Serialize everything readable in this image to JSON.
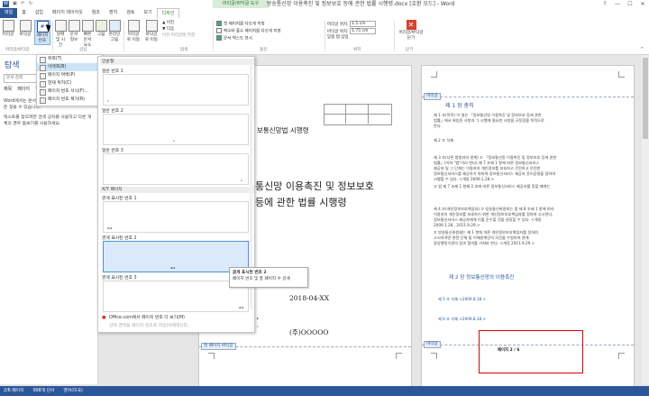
{
  "window": {
    "title": "방송통신망 이용촉진 및 정보보호 등에 관한 법률 시행령.docx [호환 모드] - Word",
    "context_group": "머리글/바닥글 도구",
    "controls": [
      "?",
      "—",
      "☐",
      "✕"
    ]
  },
  "tabs": [
    "파일",
    "홈",
    "삽입",
    "페이지 레이아웃",
    "참조",
    "편지",
    "검토",
    "보기",
    "디자인"
  ],
  "ribbon": {
    "header_footer": {
      "header": "머리글",
      "footer": "바닥글",
      "page_number": "페이지 번호",
      "group": "머리글/바닥글"
    },
    "insert": {
      "datetime": "날짜 및 시간",
      "docinfo": "문서 정보",
      "quick": "빠른 문서 요소",
      "picture": "그림",
      "online": "온라인 그림",
      "group": "삽입"
    },
    "nav": {
      "go_header": "머리글로 이동",
      "go_footer": "바닥글로 이동",
      "prev": "이전",
      "next": "다음",
      "link": "이전 머리글에 연결",
      "group": "탐색"
    },
    "options": {
      "first_page": "첫 페이지를 다르게 지정",
      "odd_even": "짝수와 홀수 페이지를 다르게 지정",
      "show_text": "문서 텍스트 표시",
      "group": "옵션"
    },
    "position": {
      "header_top": "머리글 위치:",
      "header_val": "1.5 cm",
      "footer_bottom": "바닥글 위치:",
      "footer_val": "1.75 cm",
      "align_tab": "맞춤 탭 삽입",
      "group": "위치"
    },
    "close": {
      "label": "머리글/바닥글 닫기",
      "group": "닫기"
    }
  },
  "nav_pane": {
    "title": "탐색",
    "search_placeholder": "문서 검색",
    "tabs": [
      "제목",
      "페이지",
      "결과"
    ],
    "text1": "Word에서는 문서에서 텍스트, 표, 그림 등 무엇이든 찾을 수 있습니다.",
    "text2": "텍스트를 찾으려면 검색 상자를 사용하고 다른 개체의 경우 돋보기를 사용하세요."
  },
  "page_number_menu": [
    {
      "label": "위쪽(T)",
      "arrow": "▸",
      "highlighted": false
    },
    {
      "label": "아래쪽(B)",
      "arrow": "▸",
      "highlighted": true
    },
    {
      "label": "페이지 여백(P)",
      "arrow": "▸",
      "highlighted": false
    },
    {
      "label": "현재 위치(C)",
      "arrow": "▸",
      "highlighted": false
    },
    {
      "label": "페이지 번호 서식(F)...",
      "arrow": "",
      "highlighted": false
    },
    {
      "label": "페이지 번호 제거(R)",
      "arrow": "",
      "highlighted": false
    }
  ],
  "gallery": {
    "section1": "단순형",
    "items": [
      {
        "label": "일반 번호 1",
        "num": "1"
      },
      {
        "label": "일반 번호 2",
        "num": "1"
      },
      {
        "label": "일반 번호 3",
        "num": "1"
      }
    ],
    "section2": "X/Y 페이지",
    "xy_items": [
      {
        "label": "굵게 표시된 번호 1",
        "num": "1/1"
      },
      {
        "label": "굵게 표시된 번호 2",
        "num": "1/1"
      },
      {
        "label": "굵게 표시된 번호 3",
        "num": "1/1"
      }
    ],
    "more": "Office.com에서 페이지 번호 더 보기(M)",
    "save": "선택 영역을 페이지 번호로 저장(아래쪽)(S)"
  },
  "tooltip": {
    "title": "굵게 표시된 번호 2",
    "desc": "페이지 번호 및 총 페이지 수 굵게"
  },
  "doc": {
    "page1": {
      "subtitle": "보통신망법 시행령",
      "title_line1": "통신망 이용촉진 및 정보보호",
      "title_line2": "등에 관한 법률 시행령",
      "date": "2018-04-XX",
      "org": "(주)OOOOO",
      "footer_tag": "첫 페이지 바닥글"
    },
    "page2": {
      "header_tag": "머리글",
      "chapter1": "제 1 장 총칙",
      "lines": [
        "제 1 조(목적) 이 영은 「정보통신망 이용촉진 및 정보보호 등에 관한",
        "법률」에서 위임된 사항과 그 시행에 필요한 사항을 규정함을 목적으로",
        "한다.",
        "제 2 조 삭제",
        "제 3 조(다른 법령과의 관계) ① 「정보통신망 이용촉진 및 정보보호 등에 관한",
        "법률」(이하 \"법\"이라 한다) 제 7 조제 1 항에 따른 정보통신서비스",
        "제공자 및 그 단체는 이용자의 개인정보를 보호하고 건전하고 안전한",
        "정보통신서비스를 제공하기 위하여 정보통신서비스 제공자 윤리강령을 정하여",
        "시행할 수 있다. <개정 2009.1.28.>",
        "② 법 제 7 조제 1 항제 2 호에 따른 정보통신서비스 제공자를 정할 때에는",
        "제 4 조(개인정보보호책임자) ① 방송통신위원회는 법 제 8 조제 1 항에 따라",
        "이용자의 개인정보를 보호하기 위한 개인정보보호책임자를 정하여 고시한다.",
        "정보통신서비스 제공자에게 이를 준수할 것을 권장할 수 있다. <개정",
        "2009.1.28., 2011.9.29.>",
        "② 방송통신위원회는 제 1 항에 따른 개인정보보호책임자를 정하여",
        "고시하려면 관련 단체 및 이해관계인의 의견을 수렴하여 관계",
        "중앙행정기관의 장과 협의를 거쳐야 한다. <개정 2011.9.29.>"
      ],
      "chapter2": "제 2 장 정보통신망의 이용촉진",
      "article5": "제 5 조 삭제 <2009.8.18.>",
      "article6": "제 6 조 삭제 <2009.8.18.>",
      "footer_tag": "바닥글",
      "footer_text": "페이지 2 / 6"
    }
  },
  "status": {
    "page": "2/6 페이지",
    "words": "998개 단어",
    "lang": "영어(미국)"
  }
}
